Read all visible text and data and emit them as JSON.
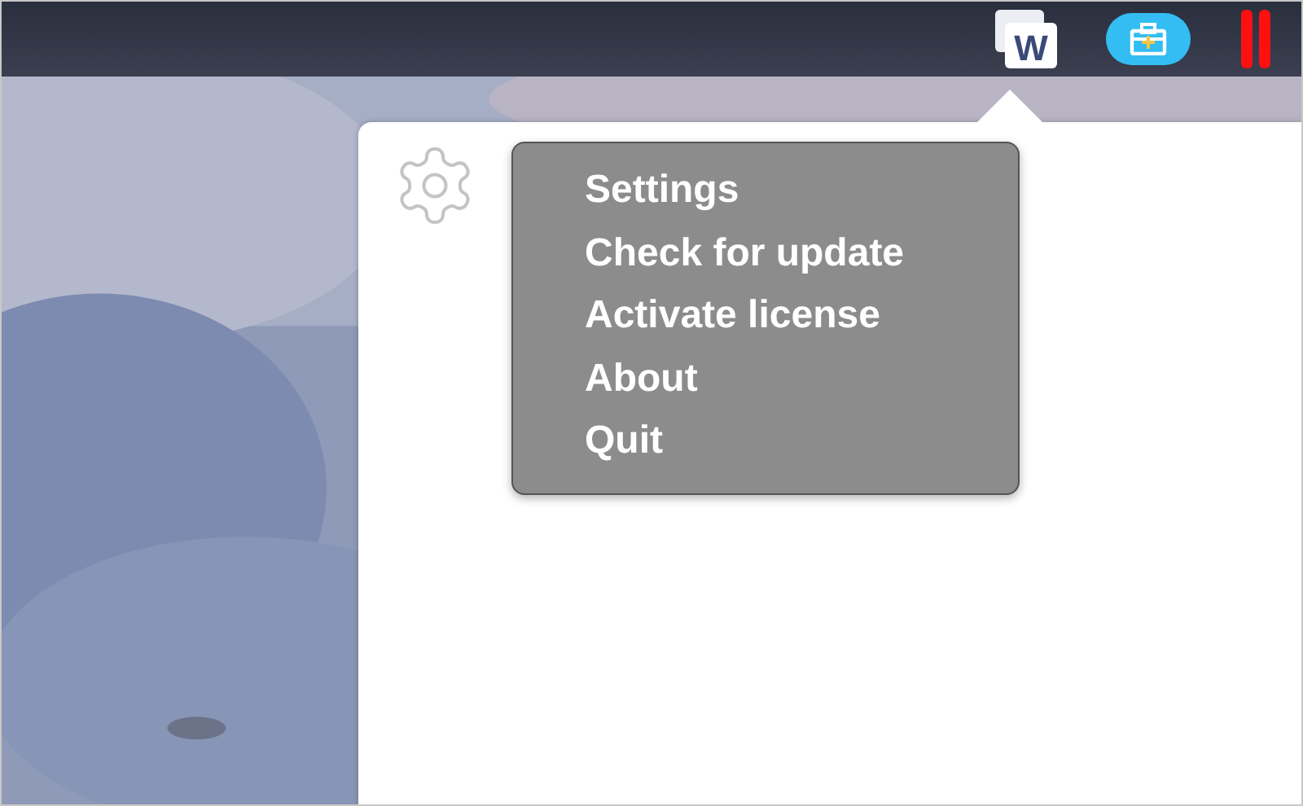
{
  "menu_bar": {
    "items": [
      {
        "kind": "app",
        "label": "W"
      },
      {
        "kind": "toolbox"
      },
      {
        "kind": "pause"
      }
    ]
  },
  "popover": {
    "menu": {
      "items": [
        {
          "label": "Settings"
        },
        {
          "label": "Check for update"
        },
        {
          "label": "Activate license"
        },
        {
          "label": "About"
        },
        {
          "label": "Quit"
        }
      ]
    }
  }
}
